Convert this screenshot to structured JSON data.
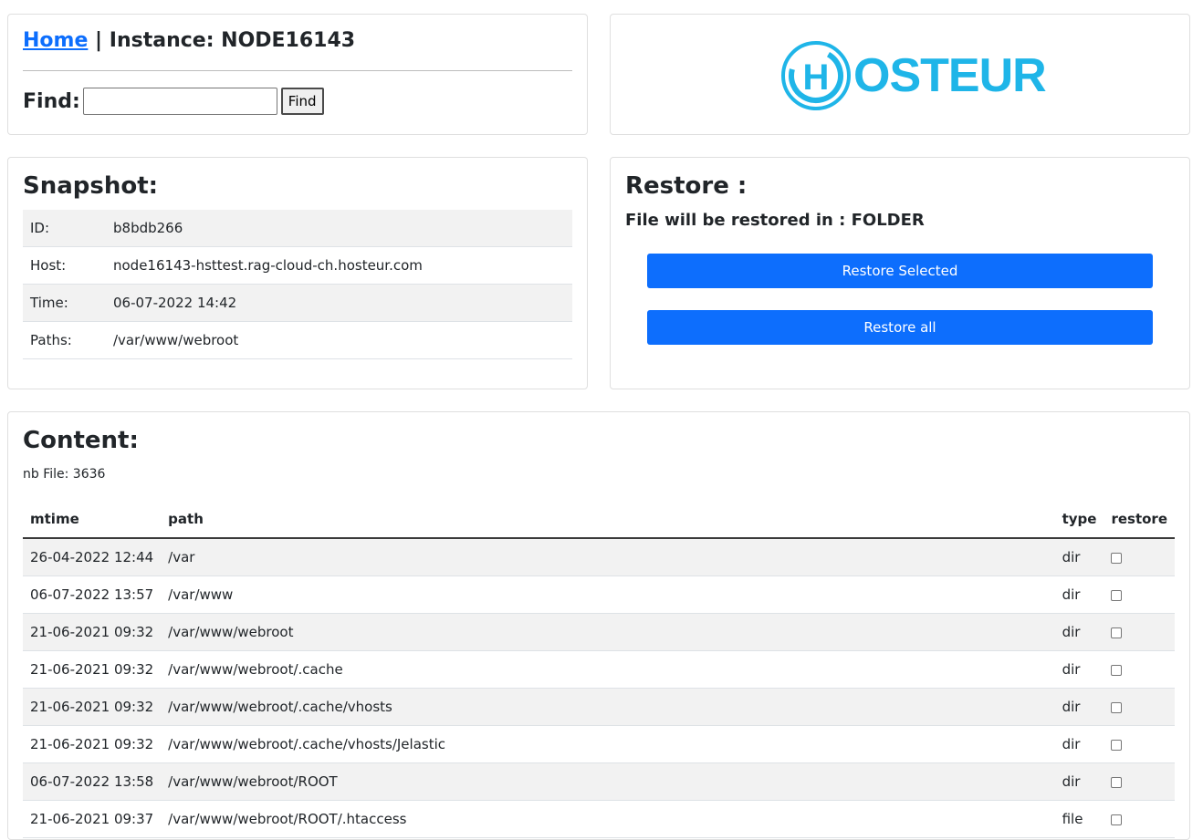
{
  "header": {
    "home_link": "Home",
    "separator": "|",
    "instance_label": "Instance: NODE16143"
  },
  "find": {
    "label": "Find:",
    "input_value": "",
    "button_label": "Find"
  },
  "logo": {
    "text": "OSTEUR",
    "mark_letter": "H",
    "color": "#1fb5e8"
  },
  "snapshot": {
    "title": "Snapshot:",
    "rows": [
      {
        "key": "ID:",
        "value": "b8bdb266"
      },
      {
        "key": "Host:",
        "value": "node16143-hsttest.rag-cloud-ch.hosteur.com"
      },
      {
        "key": "Time:",
        "value": "06-07-2022 14:42"
      },
      {
        "key": "Paths:",
        "value": "/var/www/webroot"
      }
    ]
  },
  "restore": {
    "title": "Restore :",
    "subtitle_prefix": "File will be restored in : ",
    "subtitle_target": "FOLDER",
    "selected_button": "Restore Selected",
    "all_button": "Restore all",
    "accent": "#0d6efd"
  },
  "content": {
    "title": "Content:",
    "nb_file": "nb File: 3636",
    "columns": [
      "mtime",
      "path",
      "type",
      "restore"
    ],
    "rows": [
      {
        "mtime": "26-04-2022 12:44",
        "path": "/var",
        "type": "dir"
      },
      {
        "mtime": "06-07-2022 13:57",
        "path": "/var/www",
        "type": "dir"
      },
      {
        "mtime": "21-06-2021 09:32",
        "path": "/var/www/webroot",
        "type": "dir"
      },
      {
        "mtime": "21-06-2021 09:32",
        "path": "/var/www/webroot/.cache",
        "type": "dir"
      },
      {
        "mtime": "21-06-2021 09:32",
        "path": "/var/www/webroot/.cache/vhosts",
        "type": "dir"
      },
      {
        "mtime": "21-06-2021 09:32",
        "path": "/var/www/webroot/.cache/vhosts/Jelastic",
        "type": "dir"
      },
      {
        "mtime": "06-07-2022 13:58",
        "path": "/var/www/webroot/ROOT",
        "type": "dir"
      },
      {
        "mtime": "21-06-2021 09:37",
        "path": "/var/www/webroot/ROOT/.htaccess",
        "type": "file"
      }
    ]
  }
}
